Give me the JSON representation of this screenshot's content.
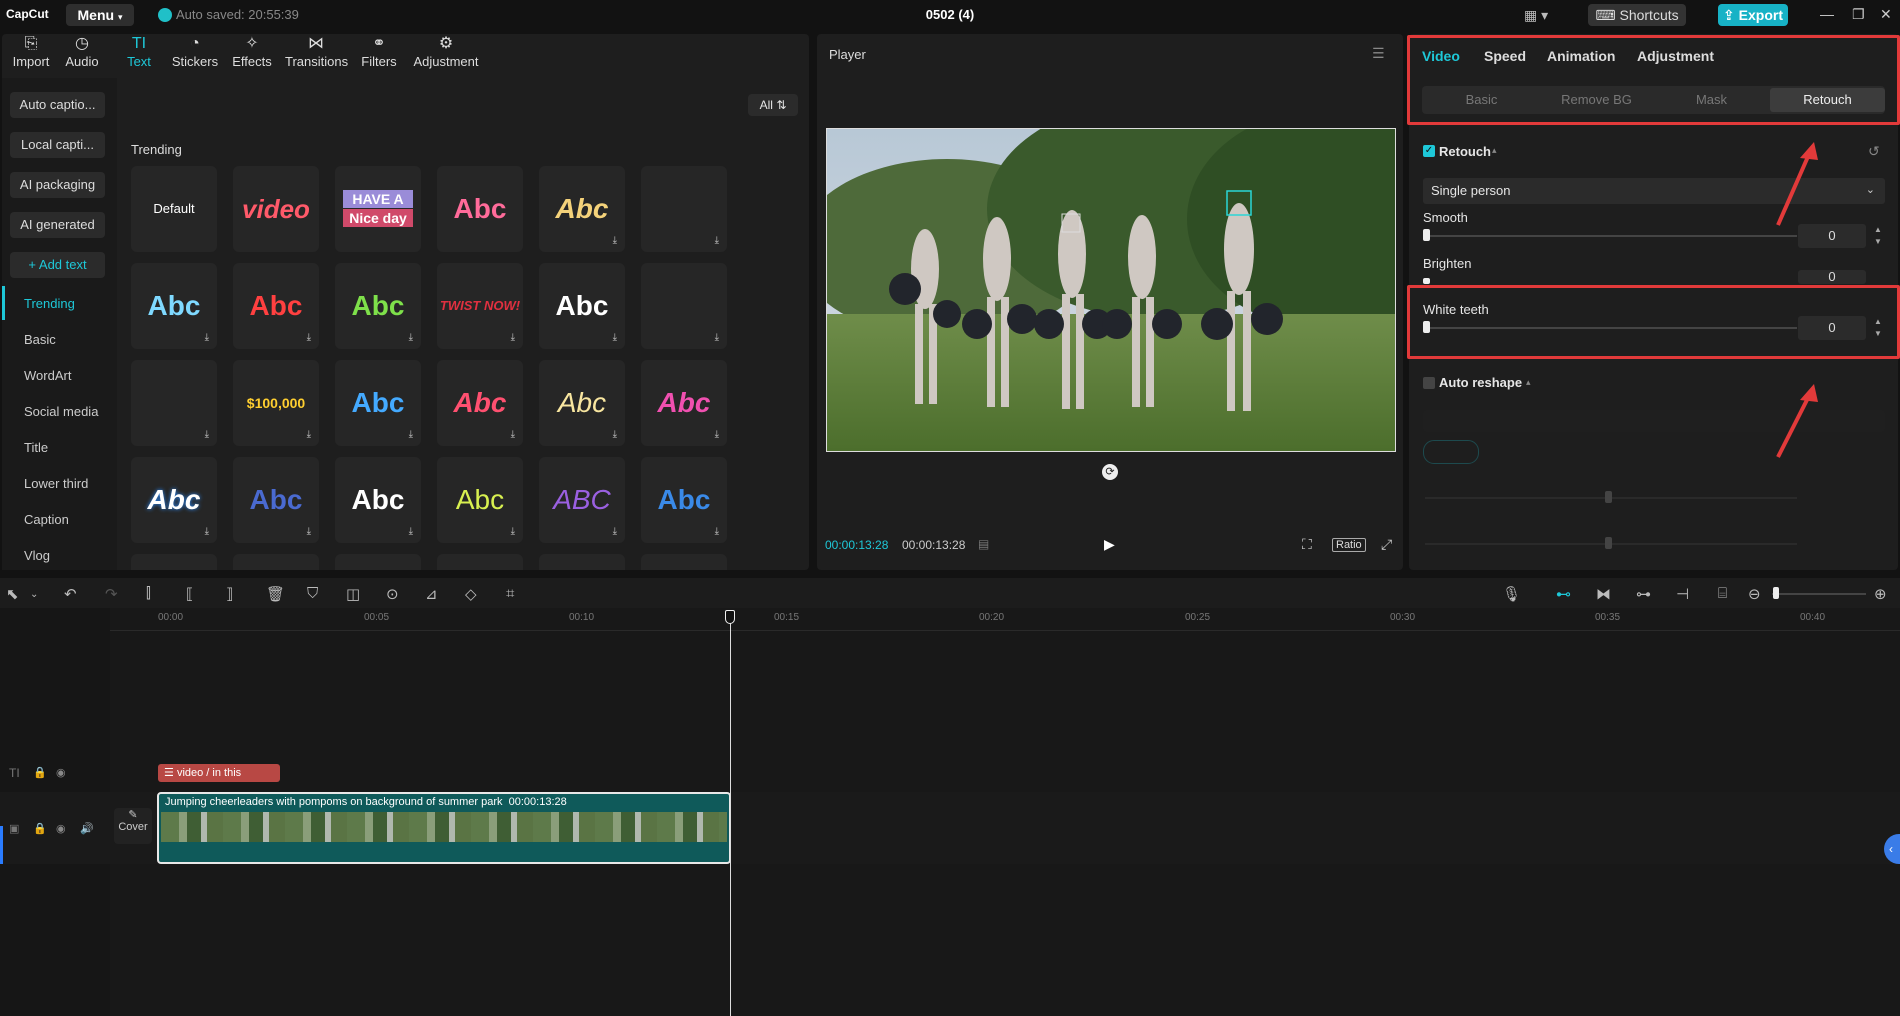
{
  "titlebar": {
    "logo": "CapCut",
    "menu": "Menu",
    "autosave": "Auto saved: 20:55:39",
    "title": "0502 (4)",
    "shortcuts": "Shortcuts",
    "export": "Export"
  },
  "toolbar": [
    {
      "label": "Import",
      "icon": "import-icon"
    },
    {
      "label": "Audio",
      "icon": "audio-icon"
    },
    {
      "label": "Text",
      "icon": "text-icon"
    },
    {
      "label": "Stickers",
      "icon": "sticker-icon"
    },
    {
      "label": "Effects",
      "icon": "effects-icon"
    },
    {
      "label": "Transitions",
      "icon": "transitions-icon"
    },
    {
      "label": "Filters",
      "icon": "filters-icon"
    },
    {
      "label": "Adjustment",
      "icon": "adjustment-icon"
    }
  ],
  "sidebar": {
    "buttons": [
      "Auto captio...",
      "Local capti...",
      "AI packaging",
      "AI generated",
      "+ Add text"
    ],
    "categories": [
      "Trending",
      "Basic",
      "WordArt",
      "Social media",
      "Title",
      "Lower third",
      "Caption",
      "Vlog"
    ]
  },
  "library": {
    "filter": "All",
    "section": "Trending",
    "row1": [
      "Default",
      "video",
      "HAVE A",
      "Nice day",
      "Abc",
      "Abc"
    ],
    "row2": [
      "Abc",
      "Abc",
      "Abc",
      "TWIST NOW!",
      "Abc"
    ],
    "row3": [
      "$100,000",
      "Abc",
      "Abc",
      "Abc",
      "Abc"
    ],
    "row4": [
      "Abc",
      "Abc",
      "Abc",
      "Abc",
      "ABC",
      "Abc"
    ]
  },
  "player": {
    "title": "Player",
    "current_time": "00:00:13:28",
    "total_time": "00:00:13:28",
    "ratio": "Ratio"
  },
  "props": {
    "tabs": [
      "Video",
      "Speed",
      "Animation",
      "Adjustment"
    ],
    "subtabs": [
      "Basic",
      "Remove BG",
      "Mask",
      "Retouch"
    ],
    "retouch_label": "Retouch",
    "person_select": "Single person",
    "smooth_label": "Smooth",
    "smooth_value": "0",
    "brighten_label": "Brighten",
    "brighten_value": "0",
    "white_teeth_label": "White teeth",
    "white_teeth_value": "0",
    "auto_reshape_label": "Auto reshape"
  },
  "timeline": {
    "ticks": [
      "00:00",
      "00:05",
      "00:10",
      "00:15",
      "00:20",
      "00:25",
      "00:30",
      "00:35",
      "00:40"
    ],
    "text_clip": "video / in this",
    "video_clip": "Jumping cheerleaders with pompoms on background of summer park",
    "video_clip_duration": "00:00:13:28",
    "cover": "Cover"
  },
  "colors": {
    "accent": "#1ec8d8",
    "highlight": "#e23a3a",
    "export": "#17b2c6"
  }
}
